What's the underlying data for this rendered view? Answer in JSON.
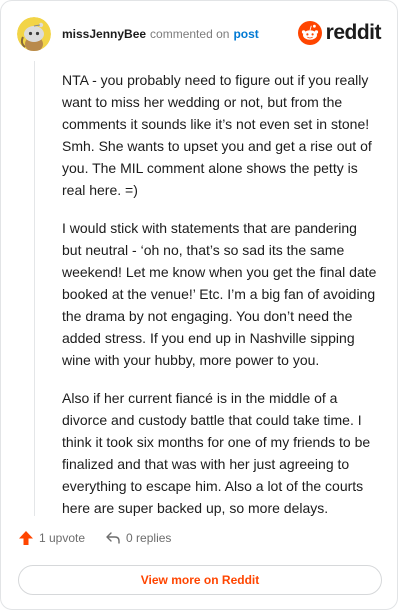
{
  "comment": {
    "username": "missJennyBee",
    "action_text": "commented on",
    "post_link": "post",
    "paragraphs": [
      "NTA - you probably need to figure out if you really want to miss her wedding or not, but from the comments it sounds like it’s not even set in stone! Smh. She wants to upset you and get a rise out of you. The MIL comment alone shows the petty is real here. =)",
      "I would stick with statements that are pandering but neutral - ‘oh no, that’s so sad its the same weekend! Let me know when you get the final date booked at the venue!’ Etc. I’m a big fan of avoiding the drama by not engaging. You don’t need the added stress. If you end up in Nashville sipping wine with your hubby, more power to you.",
      "Also if her current fiancé is in the middle of a divorce and custody battle that could take time. I think it took six months for one of my friends to be finalized and that was with her just agreeing to everything to escape him. Also a lot of the courts here are super backed up, so more delays."
    ]
  },
  "brand": {
    "name": "reddit",
    "color": "#ff4500"
  },
  "actions": {
    "upvote_label": "1 upvote",
    "replies_label": "0 replies"
  },
  "view_more_label": "View more on Reddit",
  "icons": {
    "avatar": "snoo-avatar-yellow",
    "brand_logo": "reddit-snoo-logo-icon",
    "upvote": "upvote-arrow-icon",
    "reply": "reply-arrow-icon"
  }
}
